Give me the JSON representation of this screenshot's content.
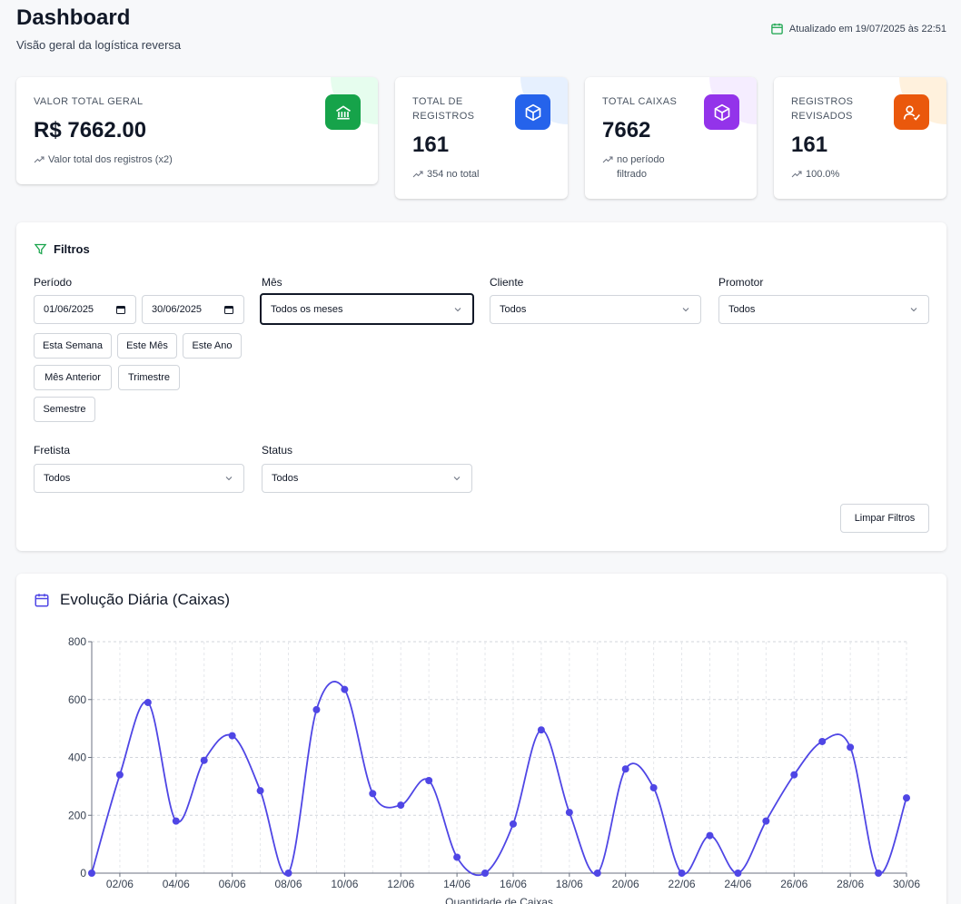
{
  "header": {
    "title": "Dashboard",
    "subtitle": "Visão geral da logística reversa",
    "updated": "Atualizado em 19/07/2025 às 22:51"
  },
  "cards": [
    {
      "label": "VALOR TOTAL GERAL",
      "value": "R$ 7662.00",
      "trend": "Valor total dos registros (x2)",
      "color": "#16a34a",
      "tint": "#dcfce7",
      "icon": "bank-icon"
    },
    {
      "label": "TOTAL DE REGISTROS",
      "value": "161",
      "trend": "354 no total",
      "color": "#2563eb",
      "tint": "#dbeafe",
      "icon": "package-icon"
    },
    {
      "label": "TOTAL CAIXAS",
      "value": "7662",
      "trend": "no período filtrado",
      "color": "#9333ea",
      "tint": "#f3e8ff",
      "icon": "package-icon"
    },
    {
      "label": "REGISTROS REVISADOS",
      "value": "161",
      "trend": "100.0%",
      "color": "#ea580c",
      "tint": "#ffedd5",
      "icon": "user-check-icon"
    }
  ],
  "filters": {
    "title": "Filtros",
    "periodo_label": "Período",
    "date_start": "01/06/2025",
    "date_end": "30/06/2025",
    "mes_label": "Mês",
    "mes_value": "Todos os meses",
    "cliente_label": "Cliente",
    "cliente_value": "Todos",
    "promotor_label": "Promotor",
    "promotor_value": "Todos",
    "quick": [
      "Esta Semana",
      "Este Mês",
      "Este Ano",
      "Mês Anterior",
      "Trimestre",
      "Semestre"
    ],
    "fretista_label": "Fretista",
    "fretista_value": "Todos",
    "status_label": "Status",
    "status_value": "Todos",
    "clear_label": "Limpar Filtros"
  },
  "chart": {
    "title": "Evolução Diária (Caixas)",
    "accent": "#4f46e5"
  },
  "chart_data": {
    "type": "line",
    "title": "Evolução Diária (Caixas)",
    "xlabel": "Quantidade de Caixas",
    "ylabel": "",
    "ylim": [
      0,
      800
    ],
    "yticks": [
      0,
      200,
      400,
      600,
      800
    ],
    "x": [
      "01/06",
      "02/06",
      "03/06",
      "04/06",
      "05/06",
      "06/06",
      "07/06",
      "08/06",
      "09/06",
      "10/06",
      "11/06",
      "12/06",
      "13/06",
      "14/06",
      "15/06",
      "16/06",
      "17/06",
      "18/06",
      "19/06",
      "20/06",
      "21/06",
      "22/06",
      "23/06",
      "24/06",
      "25/06",
      "26/06",
      "27/06",
      "28/06",
      "29/06",
      "30/06"
    ],
    "xtick_labels": [
      "02/06",
      "04/06",
      "06/06",
      "08/06",
      "10/06",
      "12/06",
      "14/06",
      "16/06",
      "18/06",
      "20/06",
      "22/06",
      "24/06",
      "26/06",
      "28/06",
      "30/06"
    ],
    "series": [
      {
        "values": [
          0,
          340,
          590,
          180,
          390,
          475,
          285,
          0,
          565,
          635,
          275,
          235,
          320,
          55,
          0,
          170,
          495,
          210,
          0,
          360,
          295,
          0,
          130,
          0,
          180,
          340,
          455,
          435,
          0,
          260
        ]
      }
    ],
    "grid": true
  }
}
